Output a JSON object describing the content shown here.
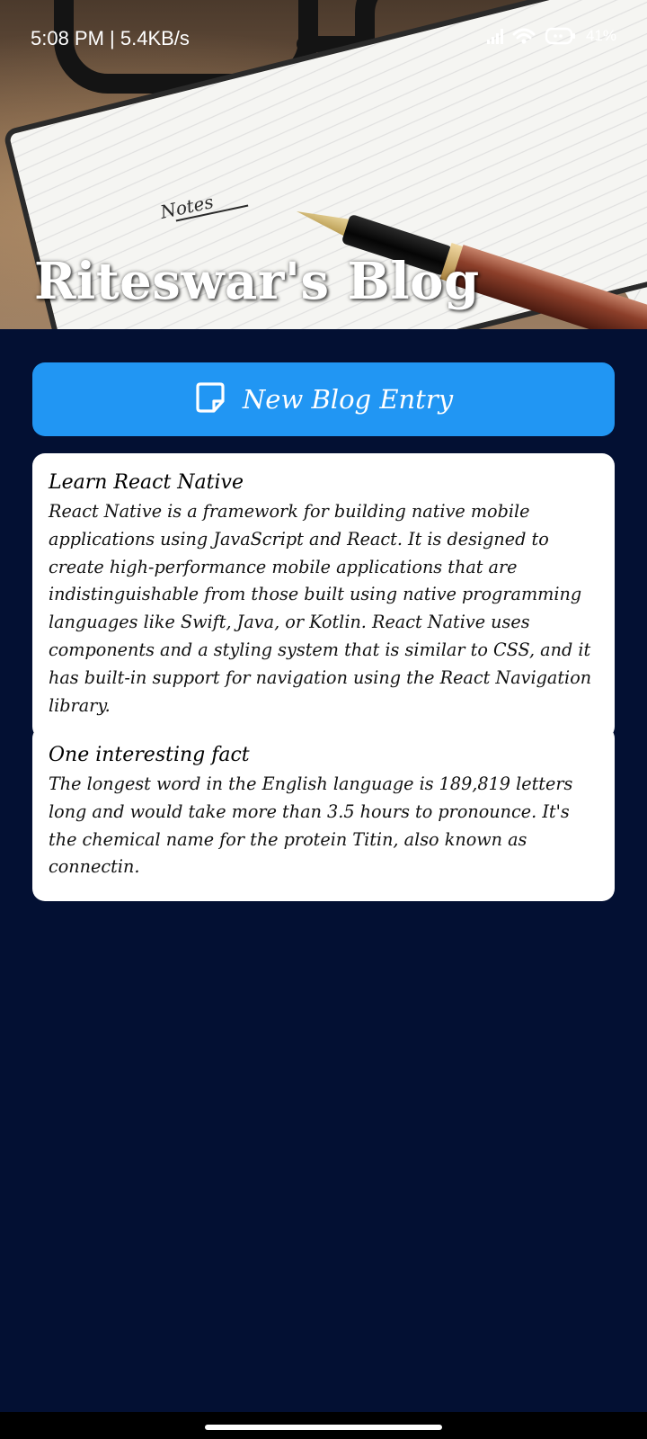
{
  "status_bar": {
    "time": "5:08 PM | 5.4KB/s",
    "battery": "41%"
  },
  "header": {
    "title": "Riteswar's Blog",
    "notes_label": "Notes"
  },
  "actions": {
    "new_entry_label": "New Blog Entry"
  },
  "posts": [
    {
      "title": "Learn React Native",
      "body": "React Native is a framework for building native mobile applications using JavaScript and React. It is designed to create high-performance mobile applications that are indistinguishable from those built using native programming languages like Swift, Java, or Kotlin. React Native uses components and a styling system that is similar to CSS, and it has built-in support for navigation using the React Navigation library."
    },
    {
      "title": "One interesting fact",
      "body": "The longest word in the English language is 189,819 letters long and would take more than 3.5 hours to pronounce. It's the chemical name for the protein Titin, also known as connectin."
    }
  ],
  "colors": {
    "background": "#031033",
    "button": "#2196f3",
    "card": "#ffffff"
  },
  "icons": {
    "signal": "signal-icon",
    "wifi": "wifi-icon",
    "battery": "battery-icon",
    "new_entry": "note-icon"
  }
}
